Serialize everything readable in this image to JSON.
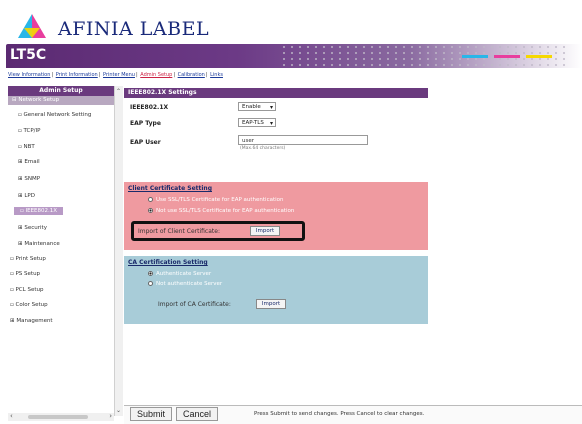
{
  "brand": {
    "name": "AFINIA LABEL"
  },
  "model": "LT5C",
  "nav_links": [
    {
      "label": "View Information",
      "active": false
    },
    {
      "label": "Print Information",
      "active": false
    },
    {
      "label": "Printer Menu",
      "active": false
    },
    {
      "label": "Admin Setup",
      "active": true
    },
    {
      "label": "Calibration",
      "active": false
    },
    {
      "label": "Links",
      "active": false
    }
  ],
  "sidebar": {
    "header": "Admin Setup",
    "sub": "Network Setup",
    "items": [
      {
        "label": "General Network Setting",
        "icon": "doc"
      },
      {
        "label": "TCP/IP",
        "icon": "doc"
      },
      {
        "label": "NBT",
        "icon": "doc"
      },
      {
        "label": "Email",
        "icon": "plus"
      },
      {
        "label": "SNMP",
        "icon": "plus"
      },
      {
        "label": "LPD",
        "icon": "plus"
      },
      {
        "label": "IEEE802.1X",
        "icon": "doc",
        "selected": true
      },
      {
        "label": "Security",
        "icon": "plus"
      },
      {
        "label": "Maintenance",
        "icon": "plus"
      },
      {
        "label": "Print Setup",
        "icon": "doc"
      },
      {
        "label": "PS Setup",
        "icon": "doc"
      },
      {
        "label": "PCL Setup",
        "icon": "doc"
      },
      {
        "label": "Color Setup",
        "icon": "doc"
      },
      {
        "label": "Management",
        "icon": "plus"
      }
    ]
  },
  "main": {
    "section_title": "IEEE802.1X Settings",
    "fields": {
      "ieee_label": "IEEE802.1X",
      "ieee_value": "Enable",
      "eap_type_label": "EAP Type",
      "eap_type_value": "EAP-TLS",
      "eap_user_label": "EAP User",
      "eap_user_value": "user",
      "eap_user_hint": "(Max.64 characters)"
    },
    "client_cert": {
      "title": "Client Certificate Setting",
      "options": [
        {
          "label": "Use SSL/TLS Certificate for EAP authentication",
          "selected": false
        },
        {
          "label": "Not use SSL/TLS Certificate for EAP authentication",
          "selected": true
        }
      ],
      "import_label": "Import of Client Certificate:",
      "import_button": "Import"
    },
    "ca_cert": {
      "title": "CA Certification Setting",
      "options": [
        {
          "label": "Authenticate Server",
          "selected": true
        },
        {
          "label": "Not authenticate Server",
          "selected": false
        }
      ],
      "import_label": "Import of CA Certificate:",
      "import_button": "Import"
    }
  },
  "footer": {
    "submit": "Submit",
    "cancel": "Cancel",
    "message": "Press Submit to send changes. Press Cancel to clear changes."
  },
  "colors": {
    "purple": "#6a3a7e",
    "client_box": "#ef9aa0",
    "ca_box": "#a8ccd8",
    "cyan": "#29b6e8",
    "magenta": "#e83e9e",
    "yellow": "#f5d800"
  }
}
